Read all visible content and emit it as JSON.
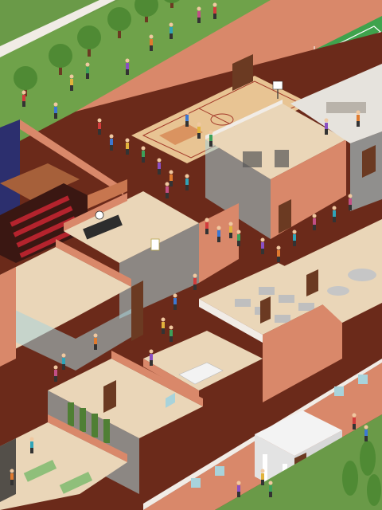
{
  "palette": {
    "grass": "#6a9a48",
    "grass_dark": "#4f7f34",
    "wall_top": "#d9886a",
    "wall_side": "#c7764f",
    "wall_light": "#f1ece6",
    "corridor": "#6b2a1a",
    "floor_wood": "#e8c493",
    "court_green": "#3fa34d",
    "glass": "#a8d3db",
    "stage_curtain": "#2c2f6e",
    "seat_red": "#b4232d",
    "door": "#6b3a22",
    "portico": "#f3f3f3"
  },
  "icons": {
    "tree": "tree-icon",
    "person": "person-icon",
    "door": "door-icon",
    "basketball_hoop": "basketball-hoop-icon",
    "tennis_net": "tennis-net-icon",
    "clock": "clock-icon"
  },
  "rooms": [
    {
      "id": "courtyard-lawn"
    },
    {
      "id": "tennis-court"
    },
    {
      "id": "basketball-gym"
    },
    {
      "id": "fitness-room"
    },
    {
      "id": "cafeteria"
    },
    {
      "id": "auditorium"
    },
    {
      "id": "classroom"
    },
    {
      "id": "computer-lab"
    },
    {
      "id": "office-cubicles"
    },
    {
      "id": "reception"
    },
    {
      "id": "library"
    },
    {
      "id": "science-lab"
    },
    {
      "id": "lounge"
    },
    {
      "id": "main-entrance"
    }
  ]
}
